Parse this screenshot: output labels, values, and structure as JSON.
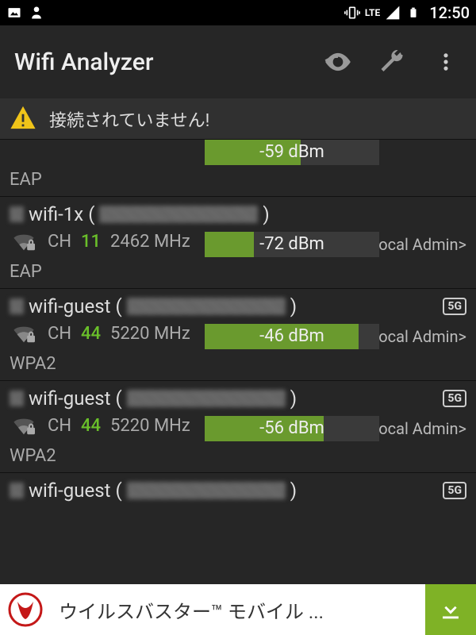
{
  "status_bar": {
    "time": "12:50",
    "lte_label": "LTE"
  },
  "app_bar": {
    "title": "Wifi Analyzer"
  },
  "warning": {
    "text": "接続されていません!"
  },
  "networks": [
    {
      "ssid": "",
      "mac_hidden": true,
      "channel": "",
      "freq": "",
      "dbm": "-59 dBm",
      "dbm_fill": 55,
      "security": "EAP",
      "admin_tag": "",
      "band": ""
    },
    {
      "ssid": "wifi-1x",
      "mac_hidden": true,
      "channel": "11",
      "freq": "2462 MHz",
      "dbm": "-72 dBm",
      "dbm_fill": 28,
      "security": "EAP",
      "admin_tag": "<Local Admin>",
      "band": ""
    },
    {
      "ssid": "wifi-guest",
      "mac_hidden": true,
      "channel": "44",
      "freq": "5220 MHz",
      "dbm": "-46 dBm",
      "dbm_fill": 88,
      "security": "WPA2",
      "admin_tag": "<Local Admin>",
      "band": "5G"
    },
    {
      "ssid": "wifi-guest",
      "mac_hidden": true,
      "channel": "44",
      "freq": "5220 MHz",
      "dbm": "-56 dBm",
      "dbm_fill": 68,
      "security": "WPA2",
      "admin_tag": "<Local Admin>",
      "band": "5G"
    },
    {
      "ssid": "wifi-guest",
      "mac_hidden": true,
      "channel": "",
      "freq": "",
      "dbm": "",
      "dbm_fill": 0,
      "security": "",
      "admin_tag": "",
      "band": "5G"
    }
  ],
  "labels": {
    "ch": "CH"
  },
  "ad": {
    "text": "ウイルスバスター™ モバイル ..."
  }
}
